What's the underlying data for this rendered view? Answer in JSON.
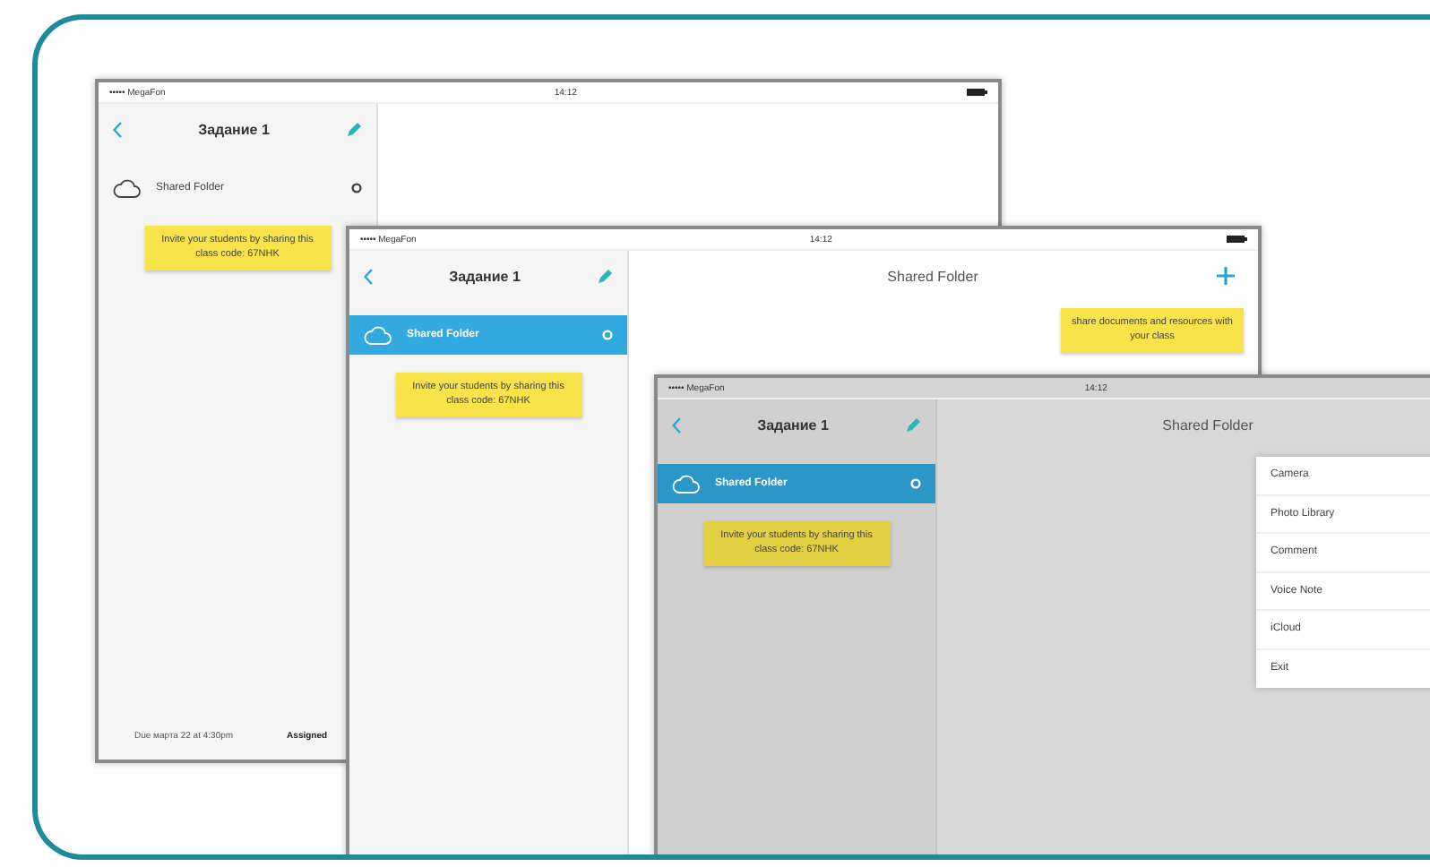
{
  "screens": [
    {
      "dimmed": false,
      "status": {
        "carrier": "••••• MegaFon",
        "time": "14:12"
      },
      "nav": {
        "title": "Задание 1"
      },
      "items": [
        {
          "label": "Shared Folder",
          "selected": false
        }
      ],
      "tooltip": "Invite your students by sharing this class code: 67NHK",
      "footer": {
        "due": "Due марта 22 at 4:30pm",
        "assigned": "Assigned"
      }
    },
    {
      "dimmed": false,
      "status": {
        "carrier": "••••• MegaFon",
        "time": "14:12"
      },
      "nav": {
        "title": "Задание 1"
      },
      "items": [
        {
          "label": "Shared Folder",
          "selected": true
        }
      ],
      "tooltip": "Invite your students by sharing this class code: 67NHK",
      "detail": {
        "title": "Shared Folder",
        "add_button": true,
        "tooltip": "share documents and resources with your class"
      }
    },
    {
      "dimmed": true,
      "status": {
        "carrier": "••••• MegaFon",
        "time": "14:12"
      },
      "nav": {
        "title": "Задание 1"
      },
      "items": [
        {
          "label": "Shared Folder",
          "selected": true
        }
      ],
      "tooltip": "Invite your students by sharing this class code: 67NHK",
      "detail": {
        "title": "Shared Folder"
      },
      "menu": [
        "Camera",
        "Photo Library",
        "Comment",
        "Voice Note",
        "iCloud",
        "Exit"
      ]
    }
  ]
}
